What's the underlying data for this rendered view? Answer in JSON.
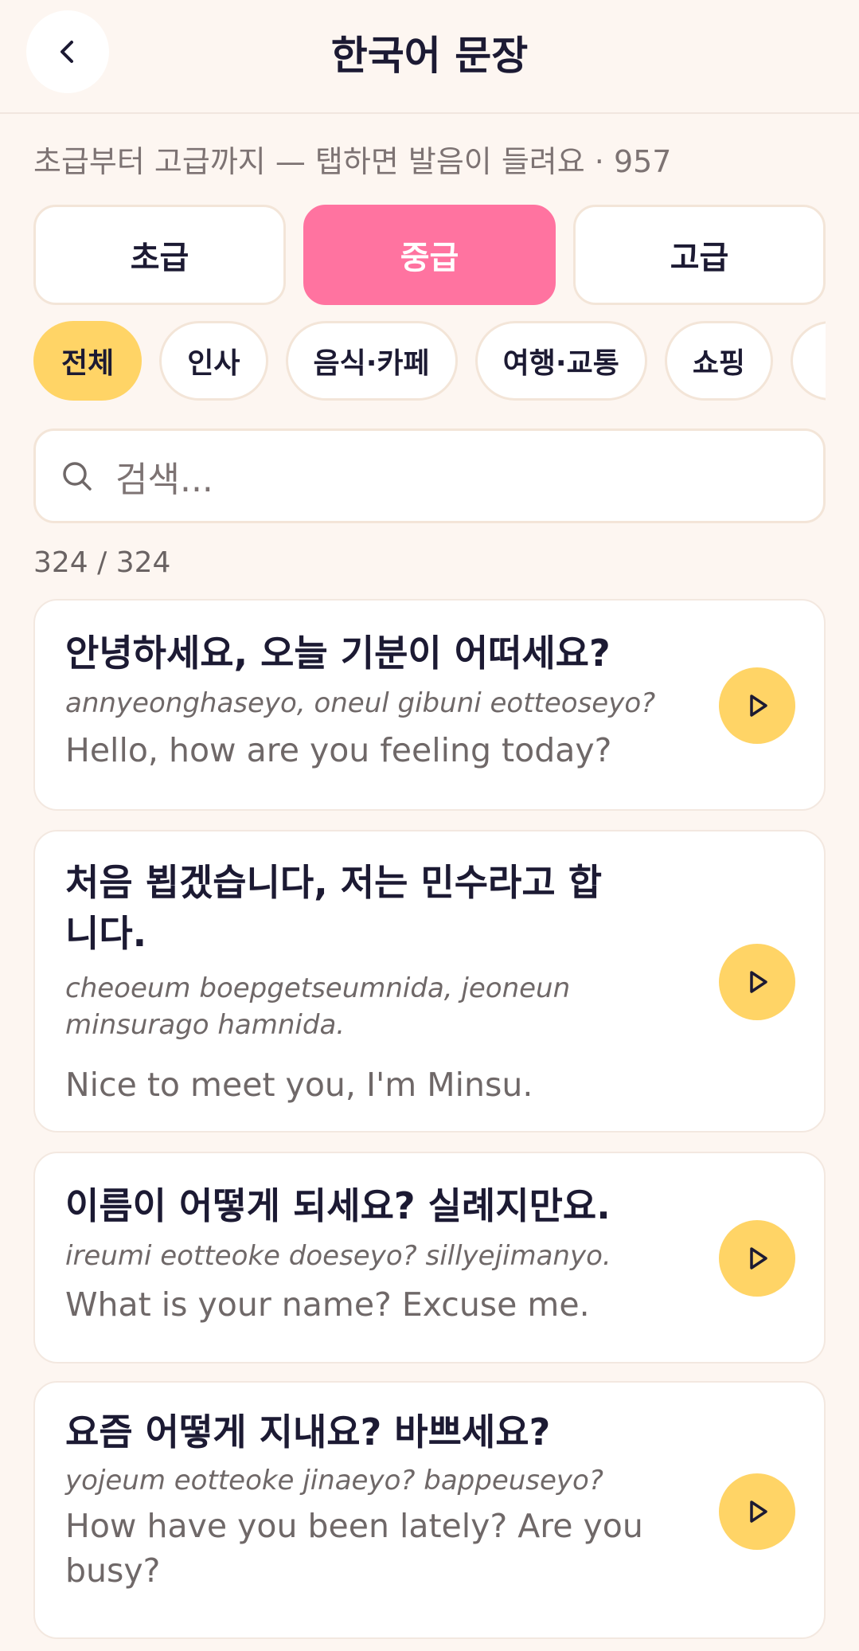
{
  "header": {
    "title": "한국어 문장",
    "back_icon": "chevron-left-icon"
  },
  "subtitle": "초급부터 고급까지 — 탭하면 발음이 들려요 · 957",
  "levels": [
    {
      "label": "초급",
      "active": false
    },
    {
      "label": "중급",
      "active": true
    },
    {
      "label": "고급",
      "active": false
    }
  ],
  "categories": [
    {
      "label": "전체",
      "active": true
    },
    {
      "label": "인사",
      "active": false
    },
    {
      "label": "음식·카페",
      "active": false
    },
    {
      "label": "여행·교통",
      "active": false
    },
    {
      "label": "쇼핑",
      "active": false
    },
    {
      "label": "",
      "active": false
    }
  ],
  "search": {
    "placeholder": "검색...",
    "icon": "search-icon"
  },
  "count": "324 / 324",
  "sentences": [
    {
      "korean": "안녕하세요, 오늘 기분이 어떠세요?",
      "romanization": "annyeonghaseyo, oneul gibuni eotteoseyo?",
      "english": "Hello, how are you feeling today?"
    },
    {
      "korean": "처음 뵙겠습니다, 저는 민수라고 합니다.",
      "romanization": "cheoeum boepgetseumnida, jeoneun minsurago hamnida.",
      "english": "Nice to meet you, I'm Minsu."
    },
    {
      "korean": "이름이 어떻게 되세요? 실례지만요.",
      "romanization": "ireumi eotteoke doeseyo? sillyejimanyo.",
      "english": "What is your name? Excuse me."
    },
    {
      "korean": "요즘 어떻게 지내요? 바쁘세요?",
      "romanization": "yojeum eotteoke jinaeyo? bappeuseyo?",
      "english": "How have you been lately? Are you busy?"
    }
  ],
  "colors": {
    "background": "#fdf6f1",
    "accent_pink": "#ff73a0",
    "accent_yellow": "#ffd466",
    "text_dark": "#1c1a33",
    "text_muted": "#6f6868"
  }
}
